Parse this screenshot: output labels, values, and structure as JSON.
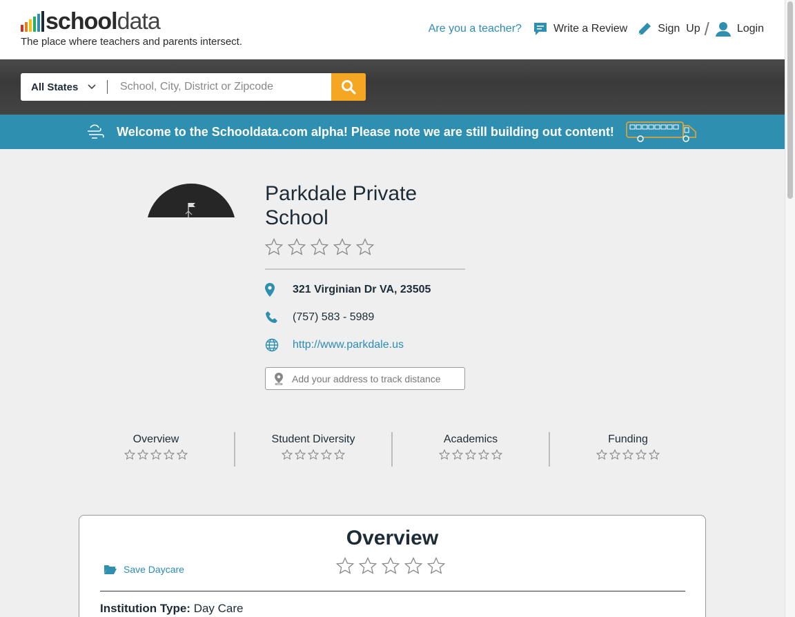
{
  "header": {
    "logo_bold": "school",
    "logo_light": "data",
    "logo_bar_colors": [
      "#c0392b",
      "#e67e22",
      "#f1c40f",
      "#27ae60",
      "#2e8fb0",
      "#1c2b36"
    ],
    "tagline": "The place where teachers and parents intersect.",
    "nav": {
      "teacher_link": "Are you a teacher?",
      "write_review": "Write a Review",
      "sign_up": "Sign  Up",
      "slash": "/",
      "login": "Login"
    }
  },
  "search": {
    "state_selected": "All States",
    "placeholder": "School, City, District or Zipcode"
  },
  "banner": {
    "message": "Welcome to the Schooldata.com alpha! Please note we are still building out content!"
  },
  "school": {
    "name": "Parkdale Private School",
    "address": "321 Virginian Dr VA, 23505",
    "phone": "(757) 583 - 5989",
    "website": "http://www.parkdale.us",
    "track_placeholder": "Add your address to track distance",
    "rating_stars": 0,
    "rating_max": 5
  },
  "categories": [
    {
      "label": "Overview",
      "stars": 0
    },
    {
      "label": "Student Diversity",
      "stars": 0
    },
    {
      "label": "Academics",
      "stars": 0
    },
    {
      "label": "Funding",
      "stars": 0
    }
  ],
  "overview": {
    "title": "Overview",
    "save_label": "Save Daycare",
    "institution_type_label": "Institution Type:",
    "institution_type_value": "Day Care"
  },
  "colors": {
    "accent_blue": "#2e8fb0",
    "link_blue": "#2b8bb3",
    "search_orange": "#f5a623",
    "text_dark": "#1c2b36"
  }
}
